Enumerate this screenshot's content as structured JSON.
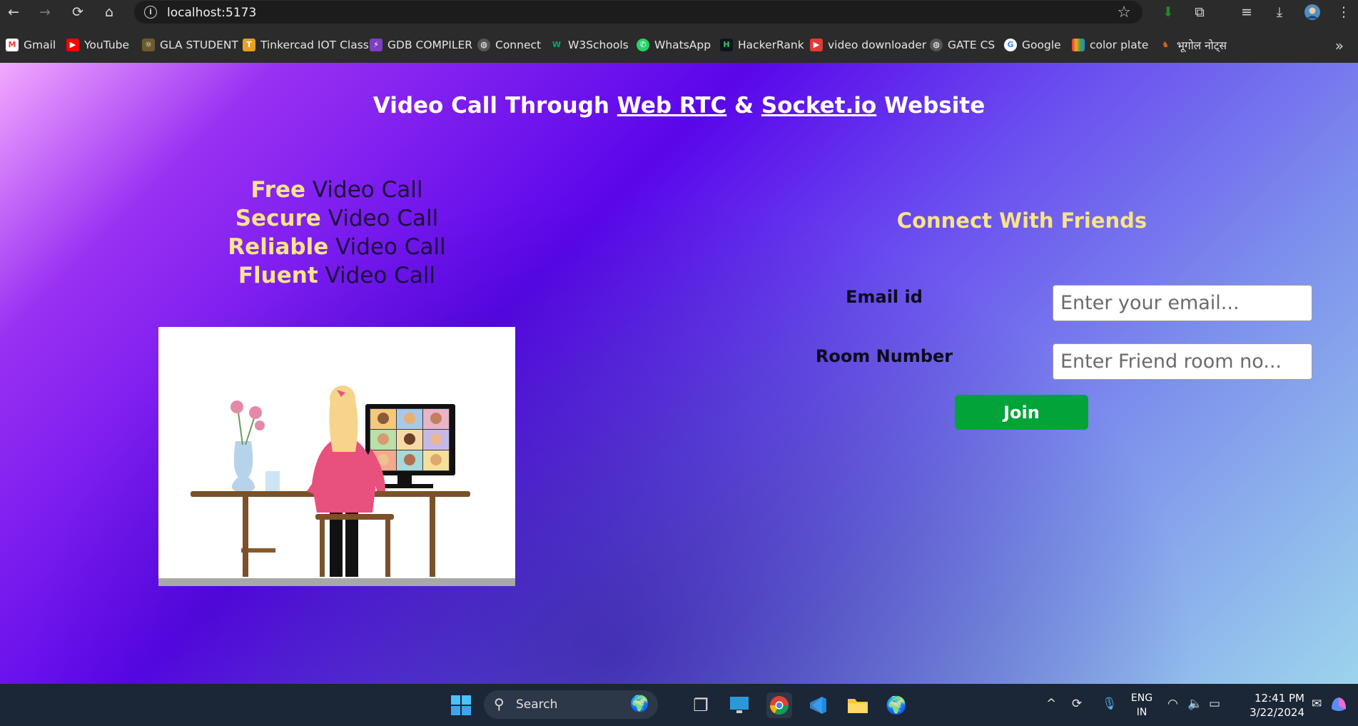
{
  "browser": {
    "url": "localhost:5173",
    "bookmarks": [
      {
        "label": "Gmail",
        "icon": "gmail-icon",
        "color": "#ea4335"
      },
      {
        "label": "YouTube",
        "icon": "youtube-icon",
        "color": "#ff0000"
      },
      {
        "label": "GLA STUDENT",
        "icon": "gla-icon",
        "color": "#6b5b2e"
      },
      {
        "label": "Tinkercad IOT Class",
        "icon": "tinkercad-icon",
        "color": "#e8a020"
      },
      {
        "label": "GDB COMPILER",
        "icon": "gdb-icon",
        "color": "#7b3fc4"
      },
      {
        "label": "Connect",
        "icon": "globe-icon",
        "color": "#888888"
      },
      {
        "label": "W3Schools",
        "icon": "w3schools-icon",
        "color": "#04aa6d"
      },
      {
        "label": "WhatsApp",
        "icon": "whatsapp-icon",
        "color": "#25d366"
      },
      {
        "label": "HackerRank",
        "icon": "hackerrank-icon",
        "color": "#0e141e"
      },
      {
        "label": "video downloader",
        "icon": "video-downloader-icon",
        "color": "#e53935"
      },
      {
        "label": "GATE CS",
        "icon": "globe-icon",
        "color": "#888888"
      },
      {
        "label": "Google",
        "icon": "google-icon",
        "color": "#4285f4"
      },
      {
        "label": "color plate",
        "icon": "color-plate-icon",
        "color": "#f5a623"
      },
      {
        "label": "भूगोल नोट्स",
        "icon": "bhugol-icon",
        "color": "#b5651d"
      }
    ]
  },
  "page": {
    "title_parts": [
      "Video Call Through ",
      "Web RTC",
      " & ",
      "Socket.io",
      " Website"
    ],
    "features": [
      {
        "bold": "Free",
        "rest": " Video Call"
      },
      {
        "bold": "Secure",
        "rest": " Video Call"
      },
      {
        "bold": "Reliable",
        "rest": " Video Call"
      },
      {
        "bold": "Fluent",
        "rest": " Video Call"
      }
    ],
    "connect_heading": "Connect With Friends",
    "email_label": "Email id",
    "email_placeholder": "Enter your email...",
    "room_label": "Room Number",
    "room_placeholder": "Enter Friend room no...",
    "join_label": "Join"
  },
  "taskbar": {
    "search_label": "Search",
    "language": "ENG",
    "region": "IN",
    "time": "12:41 PM",
    "date": "3/22/2024"
  },
  "colors": {
    "accent_yellow": "#f9e48a",
    "join_green": "#02a43a",
    "page_gradient": [
      "#f3a9ff",
      "#5a06ea",
      "#9cd4ec"
    ]
  }
}
